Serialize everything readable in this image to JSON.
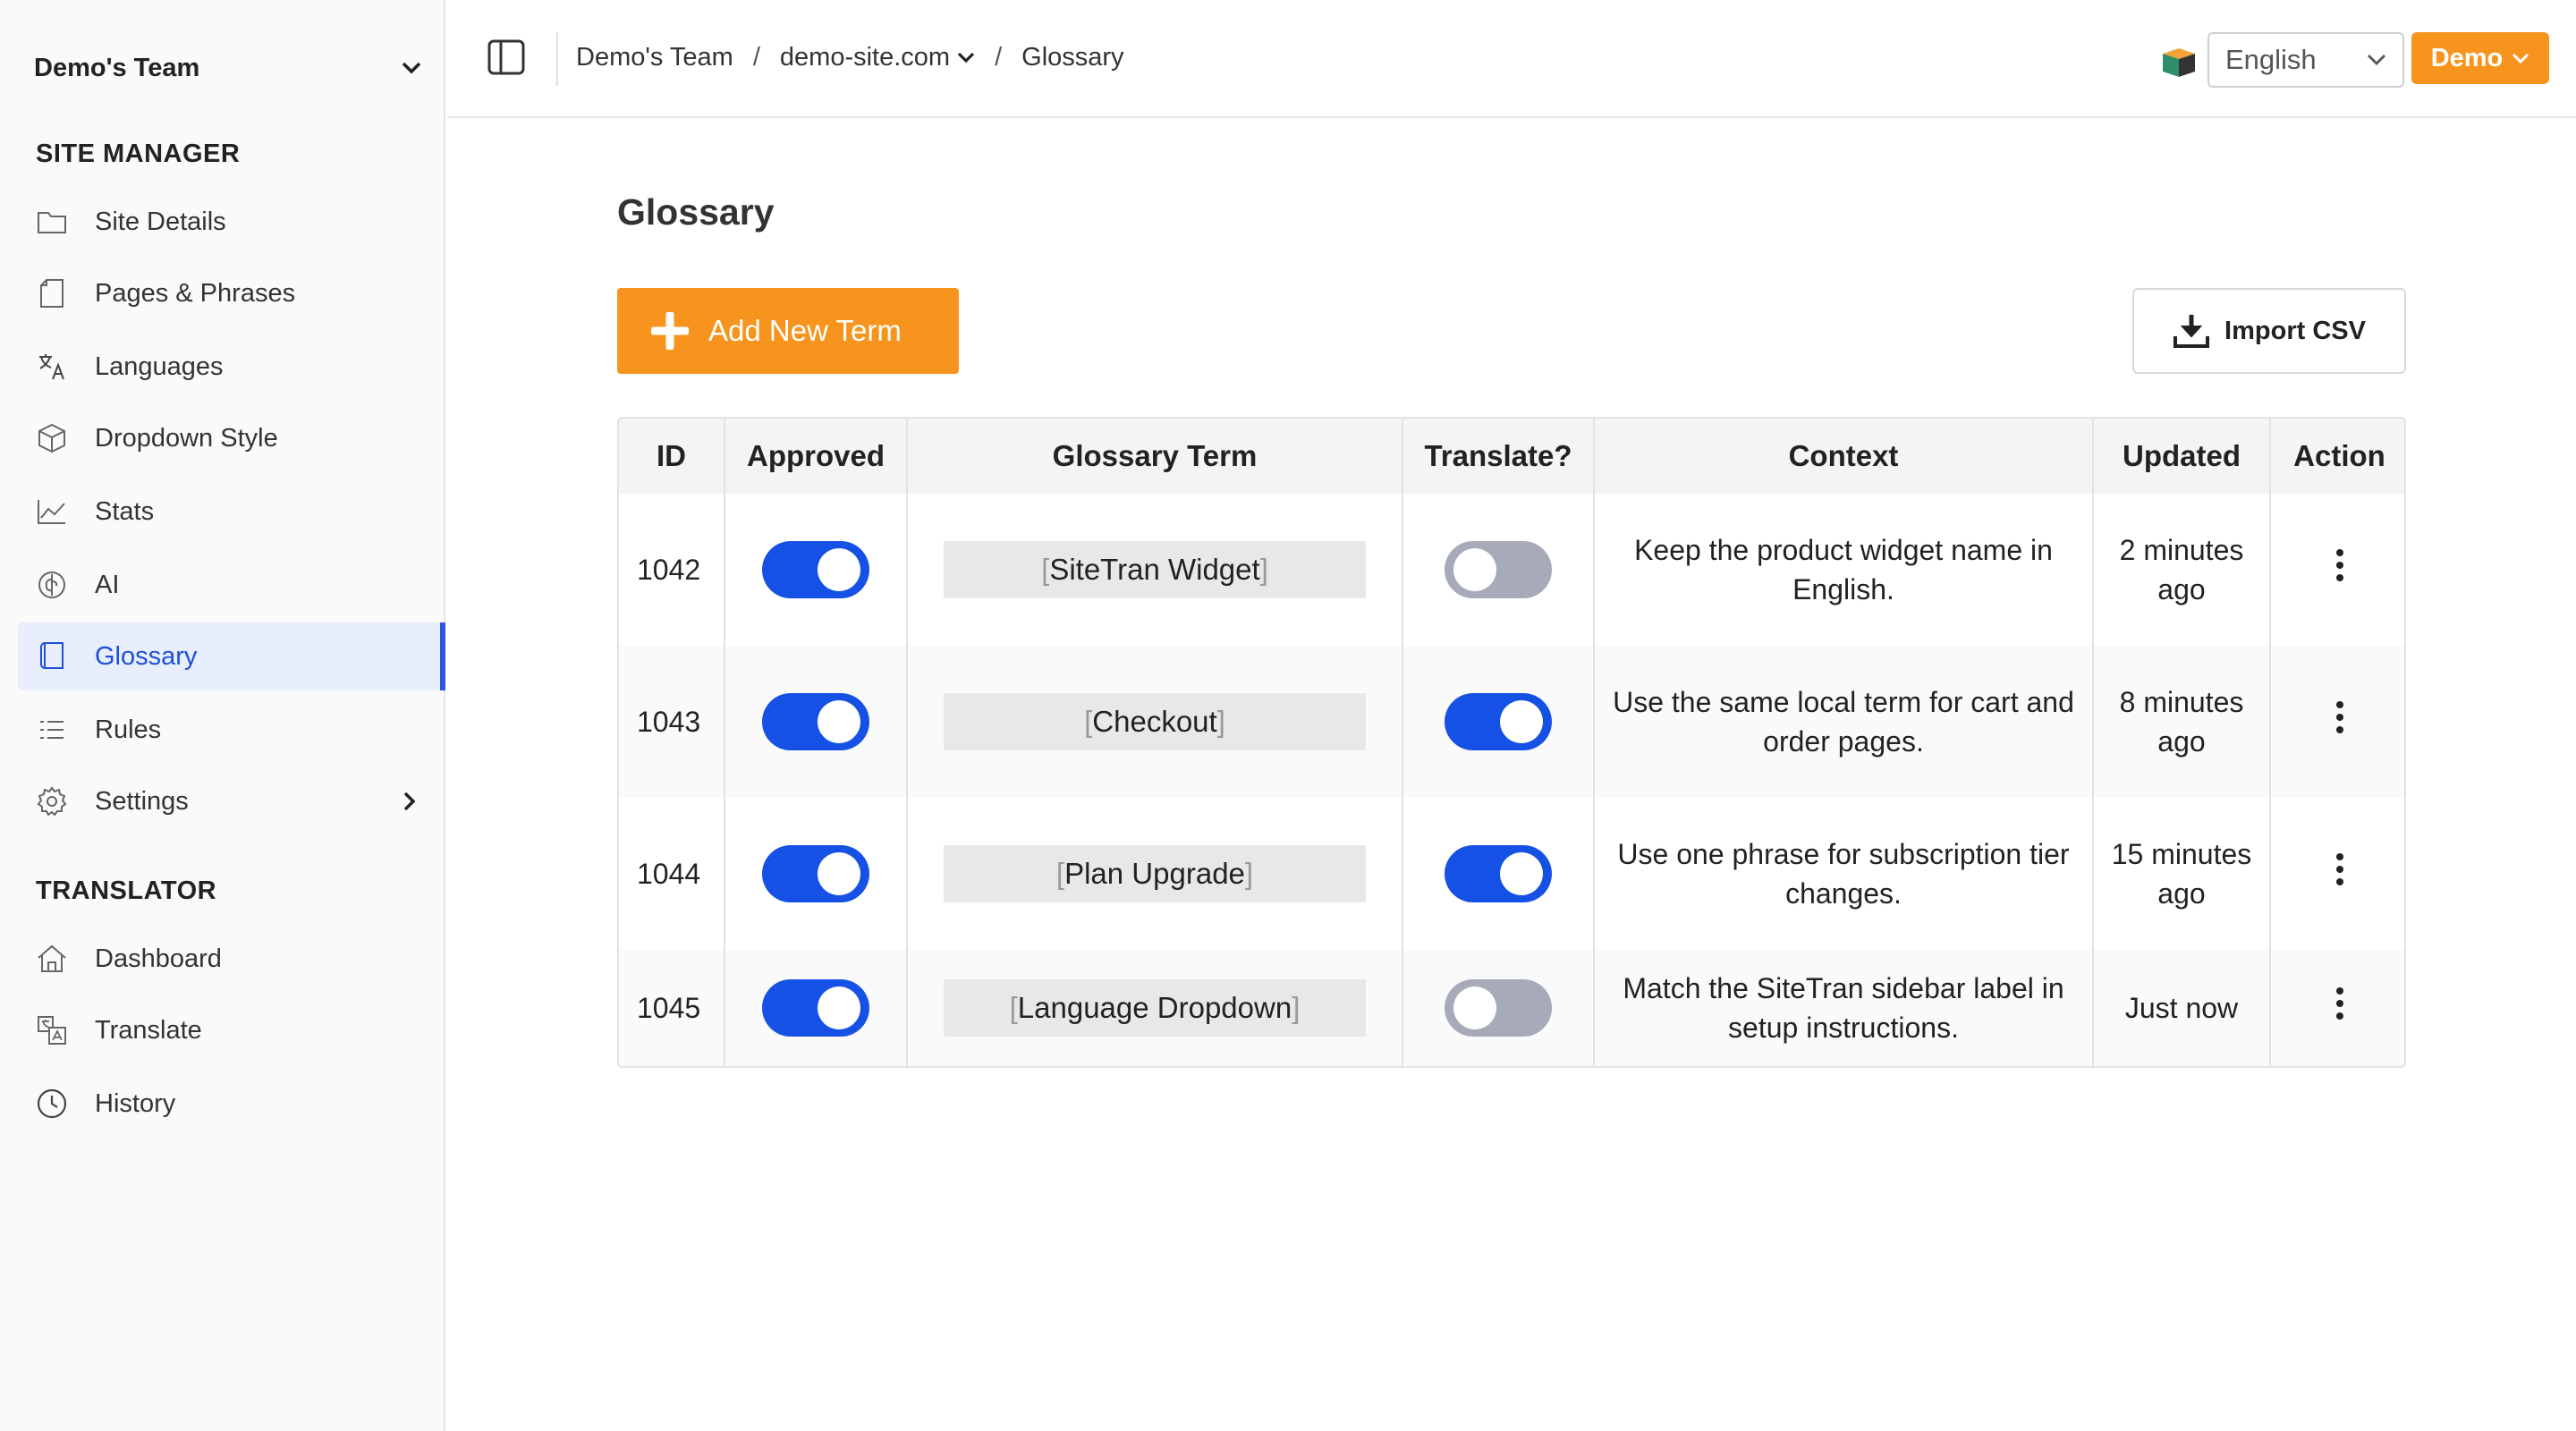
{
  "sidebar": {
    "team": "Demo's Team",
    "site_manager_heading": "SITE MANAGER",
    "translator_heading": "TRANSLATOR",
    "items": [
      {
        "label": "Site Details"
      },
      {
        "label": "Pages & Phrases"
      },
      {
        "label": "Languages"
      },
      {
        "label": "Dropdown Style"
      },
      {
        "label": "Stats"
      },
      {
        "label": "AI"
      },
      {
        "label": "Glossary"
      },
      {
        "label": "Rules"
      },
      {
        "label": "Settings"
      }
    ],
    "translator_items": [
      {
        "label": "Dashboard"
      },
      {
        "label": "Translate"
      },
      {
        "label": "History"
      }
    ]
  },
  "header": {
    "breadcrumb": [
      "Demo's Team",
      "demo-site.com",
      "Glossary"
    ],
    "separator": "/",
    "language": "English",
    "demo_label": "Demo"
  },
  "main": {
    "title": "Glossary",
    "add_label": "Add New Term",
    "import_label": "Import CSV",
    "columns": [
      "ID",
      "Approved",
      "Glossary Term",
      "Translate?",
      "Context",
      "Updated",
      "Action"
    ],
    "rows": [
      {
        "id": "1042",
        "approved": true,
        "term": "SiteTran Widget",
        "translate": false,
        "context": "Keep the product widget name in English.",
        "updated": "2 minutes ago"
      },
      {
        "id": "1043",
        "approved": true,
        "term": "Checkout",
        "translate": true,
        "context": "Use the same local term for cart and order pages.",
        "updated": "8 minutes ago"
      },
      {
        "id": "1044",
        "approved": true,
        "term": "Plan Upgrade",
        "translate": true,
        "context": "Use one phrase for subscription tier changes.",
        "updated": "15 minutes ago"
      },
      {
        "id": "1045",
        "approved": true,
        "term": "Language Dropdown",
        "translate": false,
        "context": "Match the SiteTran sidebar label in setup instructions.",
        "updated": "Just now"
      }
    ]
  },
  "colors": {
    "accent": "#f7941d",
    "primary": "#1651e6",
    "toggle_off": "#a7aab9",
    "active_bg": "#e8eefc"
  }
}
